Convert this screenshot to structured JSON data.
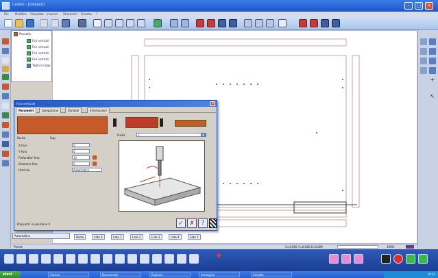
{
  "window": {
    "title": "Cadrex - [Disegno]"
  },
  "menu": [
    "File",
    "Modifica",
    "Visualizza",
    "Inserisci",
    "Strumenti",
    "Finestra",
    "?"
  ],
  "tree": {
    "root": "Pannello",
    "items": [
      "Fori verticali",
      "Fori verticali",
      "Fori verticali",
      "Fori verticali",
      "Tagli in lungo"
    ]
  },
  "dialog": {
    "title": "Foro verticale",
    "tabs": [
      "Parametri",
      "Spiegazione",
      "Variabili",
      "Informazioni"
    ],
    "fields": [
      {
        "label": "X Foro",
        "value": "0"
      },
      {
        "label": "Y Foro",
        "value": "0"
      },
      {
        "label": "Profondita' foro",
        "value": "10"
      },
      {
        "label": "Diametro foro",
        "value": "5"
      },
      {
        "label": "Utensile",
        "value": "Automatico"
      }
    ],
    "face_label": "Faccia",
    "face_value": "Sup.",
    "select_label": "Punta",
    "select_value": "1",
    "footer_text": "Proprieta' in posizione X",
    "combo_value": "Automatico",
    "accent": "#c65a28",
    "ok_label": "✓",
    "cancel_label": "✗",
    "help_label": "?"
  },
  "bottom_tabs": [
    "Pezzo",
    "Lato 0",
    "Lato 1",
    "Lato 2",
    "Lato 3",
    "Lato 4",
    "Lato 5"
  ],
  "status": {
    "left": "Pronto",
    "coords": "X=0,000  Y=0,000  Z=0,000",
    "zoom": "100%"
  },
  "taskbar": {
    "start": "start",
    "tasks": [
      "Cadrex",
      "Documento",
      "Explorer",
      "Immagine",
      "Cartella"
    ],
    "clock": "10:25"
  },
  "colors": {
    "titlebar": "#1d56c9",
    "canvas": "#ffffff",
    "panel_outline": "#c8a0a0",
    "dock": "#1a3e94"
  }
}
